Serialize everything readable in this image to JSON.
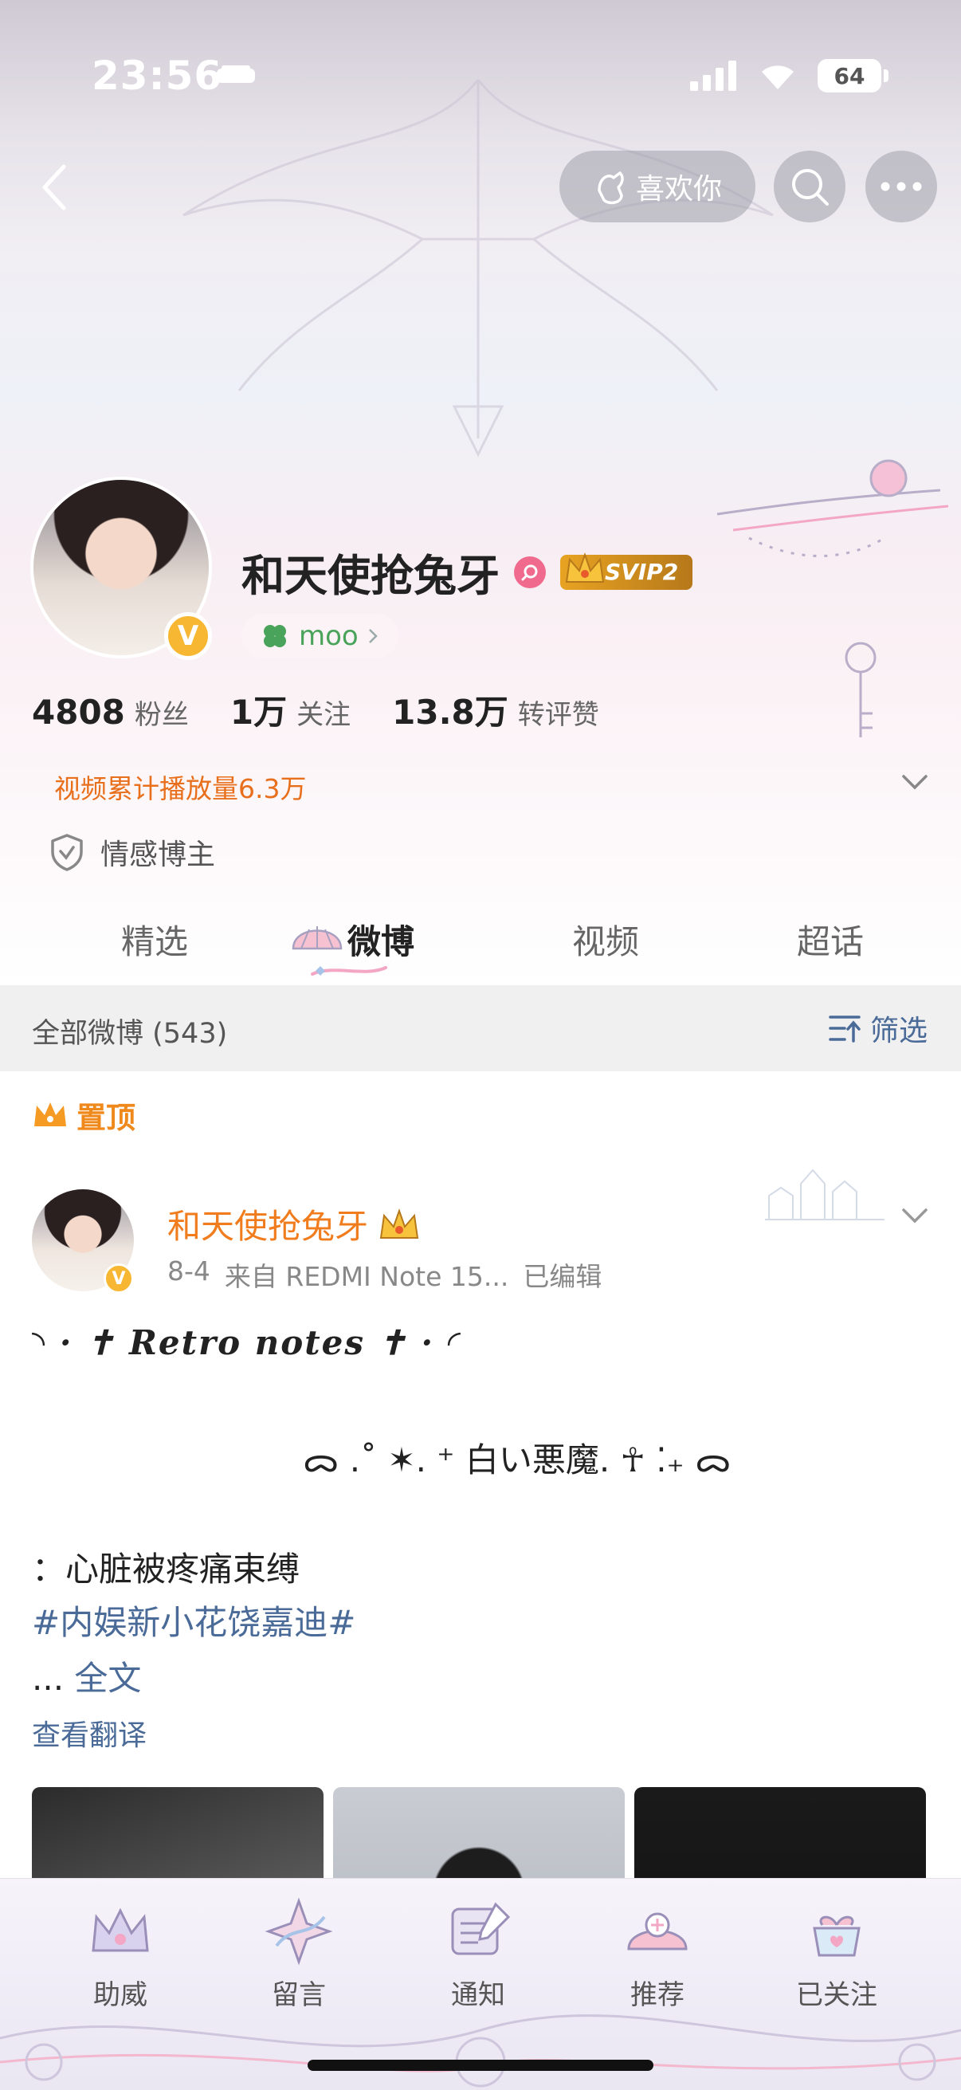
{
  "status_bar": {
    "time": "23:56",
    "battery": "64"
  },
  "nav": {
    "like_label": "喜欢你"
  },
  "profile": {
    "name": "和天使抢兔牙",
    "svip_label": "SVIP2",
    "avatar_badge": "V",
    "tag": "moo",
    "stats": [
      {
        "value": "4808",
        "label": "粉丝"
      },
      {
        "value": "1万",
        "label": "关注"
      },
      {
        "value": "13.8万",
        "label": "转评赞"
      }
    ],
    "video_count": "视频累计播放量6.3万",
    "blogger_label": "情感博主"
  },
  "tabs": [
    {
      "label": "精选",
      "active": false
    },
    {
      "label": "微博",
      "active": true
    },
    {
      "label": "视频",
      "active": false
    },
    {
      "label": "超话",
      "active": false
    }
  ],
  "filter": {
    "title": "全部微博 (543)",
    "button": "筛选"
  },
  "post": {
    "pinned_label": "置顶",
    "author": "和天使抢兔牙",
    "date": "8-4",
    "source": "来自 REDMI Note 15...",
    "edited": "已编辑",
    "line_retro": "◝ · ✝ Retro notes ✝ · ◜",
    "line_jp": "ᯅ   .˚ ✶. ⁺ 白い悪魔. ☥ ⁚₊ ᯅ",
    "line_heart": "：心脏被疼痛束缚",
    "hashtag": "#内娱新小花饶嘉迪#",
    "more_prefix": "... ",
    "full_text": "全文",
    "translate": "查看翻译"
  },
  "bottom_nav": [
    {
      "label": "助威",
      "icon": "crown-icon"
    },
    {
      "label": "留言",
      "icon": "message-icon"
    },
    {
      "label": "通知",
      "icon": "notification-icon"
    },
    {
      "label": "推荐",
      "icon": "recommend-icon"
    },
    {
      "label": "已关注",
      "icon": "followed-icon"
    }
  ],
  "colors": {
    "accent_orange": "#f07c1d",
    "link_blue": "#4a6a98",
    "svip_gold": "#e8a322",
    "tag_green": "#4aa35a"
  }
}
